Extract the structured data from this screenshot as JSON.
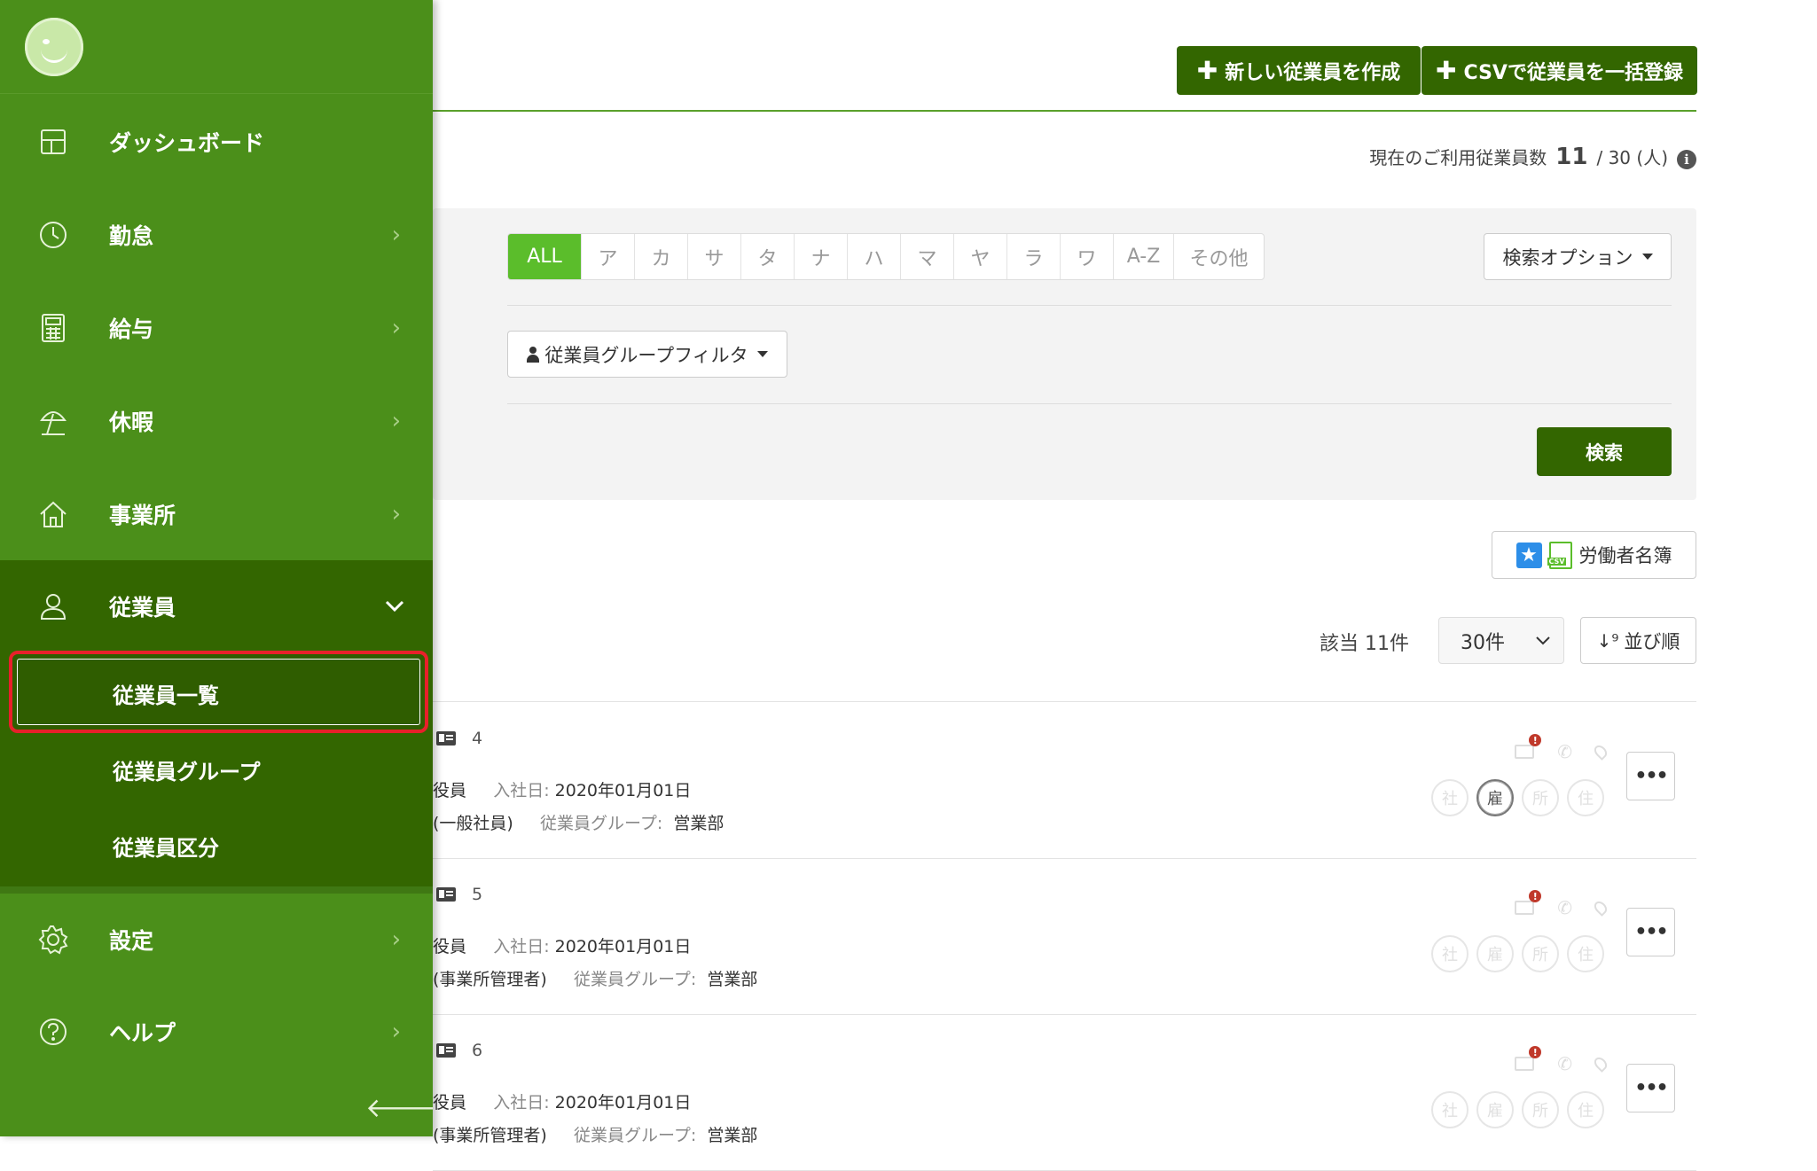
{
  "header": {
    "create_button": "新しい従業員を作成",
    "csv_button": "CSVで従業員を一括登録"
  },
  "usage": {
    "label": "現在のご利用従業員数",
    "current": "11",
    "limit": "/ 30 (人)"
  },
  "search": {
    "kana_tabs": [
      "ALL",
      "ア",
      "カ",
      "サ",
      "タ",
      "ナ",
      "ハ",
      "マ",
      "ヤ",
      "ラ",
      "ワ",
      "A-Z",
      "その他"
    ],
    "active_tab": "ALL",
    "options_button": "検索オプション",
    "group_filter": "従業員グループフィルタ",
    "search_button": "検索"
  },
  "list": {
    "roster_button": "労働者名簿",
    "count_text": "該当 11件",
    "per_page": "30件",
    "sort_button": "並び順"
  },
  "employees": [
    {
      "id": "4",
      "role": "役員",
      "joined_label": "入社日:",
      "joined": "2020年01月01日",
      "permission": "(一般社員)",
      "group_label": "従業員グループ:",
      "group": "営業部",
      "badges": [
        "社",
        "雇",
        "所",
        "住"
      ],
      "active_badge": "雇"
    },
    {
      "id": "5",
      "role": "役員",
      "joined_label": "入社日:",
      "joined": "2020年01月01日",
      "permission": "(事業所管理者)",
      "group_label": "従業員グループ:",
      "group": "営業部",
      "badges": [
        "社",
        "雇",
        "所",
        "住"
      ],
      "active_badge": ""
    },
    {
      "id": "6",
      "role": "役員",
      "joined_label": "入社日:",
      "joined": "2020年01月01日",
      "permission": "(事業所管理者)",
      "group_label": "従業員グループ:",
      "group": "営業部",
      "badges": [
        "社",
        "雇",
        "所",
        "住"
      ],
      "active_badge": ""
    }
  ],
  "sidebar": {
    "items": [
      {
        "label": "ダッシュボード",
        "icon": "dashboard-icon"
      },
      {
        "label": "勤怠",
        "icon": "clock-icon"
      },
      {
        "label": "給与",
        "icon": "calculator-icon"
      },
      {
        "label": "休暇",
        "icon": "beach-umbrella-icon"
      },
      {
        "label": "事業所",
        "icon": "home-icon"
      },
      {
        "label": "従業員",
        "icon": "user-icon"
      },
      {
        "label": "設定",
        "icon": "gear-icon"
      },
      {
        "label": "ヘルプ",
        "icon": "help-icon"
      }
    ],
    "sub_items": [
      "従業員一覧",
      "従業員グループ",
      "従業員区分"
    ],
    "active_sub": "従業員一覧"
  },
  "colors": {
    "sidebar": "#4b8f1a",
    "sidebar_dark": "#336600",
    "accent": "#5bbd2b",
    "highlight": "#e8202a"
  }
}
